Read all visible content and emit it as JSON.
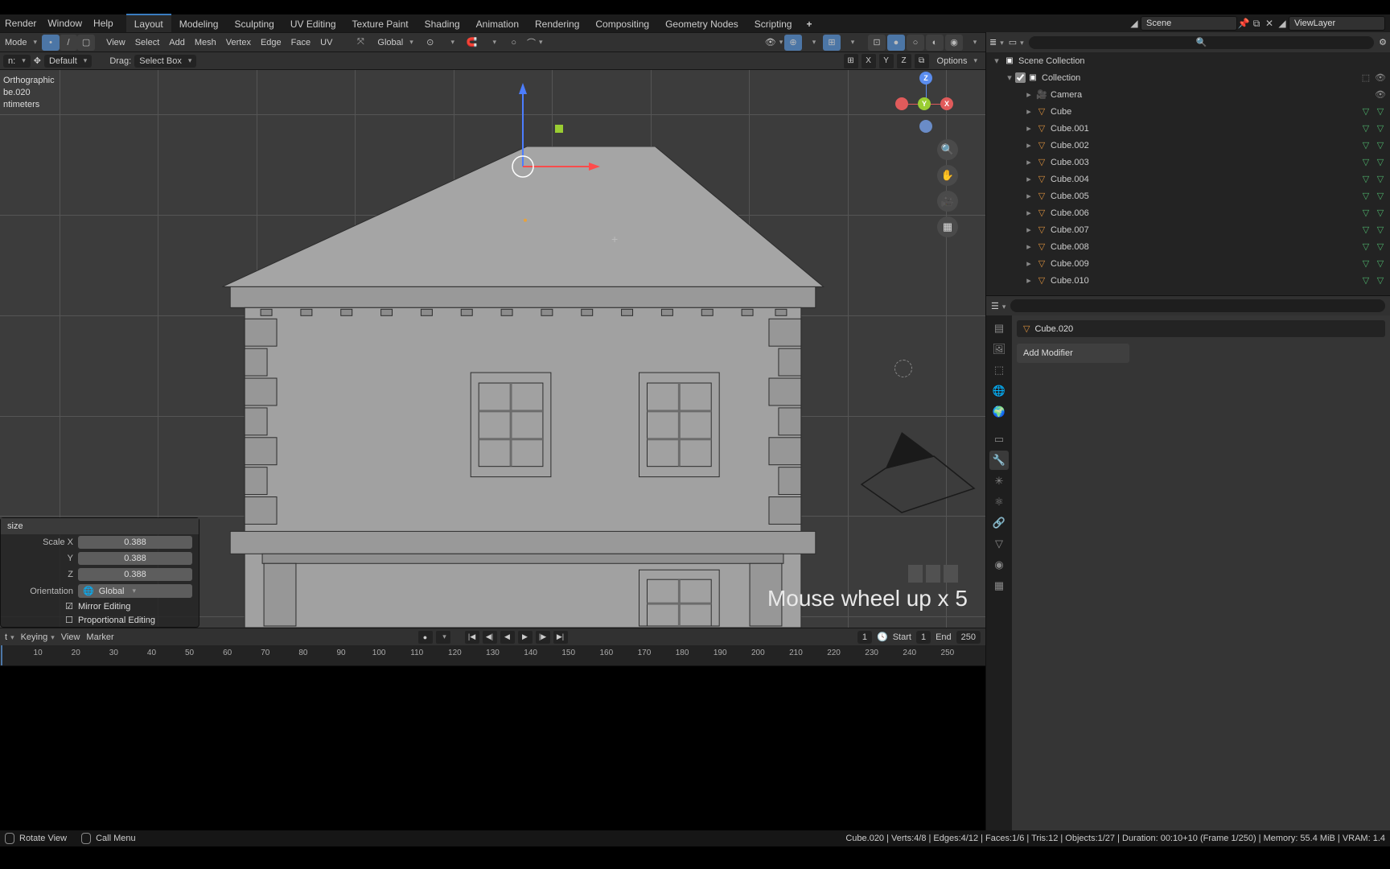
{
  "menus": {
    "app": [
      "Render",
      "Window",
      "Help"
    ]
  },
  "workspaces": [
    "Layout",
    "Modeling",
    "Sculpting",
    "UV Editing",
    "Texture Paint",
    "Shading",
    "Animation",
    "Rendering",
    "Compositing",
    "Geometry Nodes",
    "Scripting"
  ],
  "active_workspace": "Layout",
  "topbar": {
    "scene": "Scene",
    "view_layer": "ViewLayer"
  },
  "viewport_header": {
    "mode": "Mode",
    "menus": [
      "View",
      "Select",
      "Add",
      "Mesh",
      "Vertex",
      "Edge",
      "Face",
      "UV"
    ],
    "orient": "Global"
  },
  "tool_settings": {
    "preset": "Default",
    "drag_label": "Drag:",
    "drag": "Select Box",
    "xyz": [
      "X",
      "Y",
      "Z"
    ],
    "options": "Options"
  },
  "overlay": {
    "l1": "Orthographic",
    "l2": "be.020",
    "l3": "ntimeters"
  },
  "gizmo_labels": {
    "x": "X",
    "y": "Y",
    "z": "Z"
  },
  "mouse_hint": "Mouse wheel up x 5",
  "op_panel": {
    "title": "size",
    "scale_x_label": "Scale X",
    "scale_x": "0.388",
    "y_label": "Y",
    "y": "0.388",
    "z_label": "Z",
    "z": "0.388",
    "orient_label": "Orientation",
    "orient": "Global",
    "mirror": "Mirror Editing",
    "proportional": "Proportional Editing"
  },
  "timeline": {
    "keying": "Keying",
    "menus": [
      "View",
      "Marker"
    ],
    "current": "1",
    "start_label": "Start",
    "start": "1",
    "end_label": "End",
    "end": "250",
    "ticks": [
      "10",
      "20",
      "30",
      "40",
      "50",
      "60",
      "70",
      "80",
      "90",
      "100",
      "110",
      "120",
      "130",
      "140",
      "150",
      "160",
      "170",
      "180",
      "190",
      "200",
      "210",
      "220",
      "230",
      "240",
      "250"
    ]
  },
  "status": {
    "hint1": "Rotate View",
    "hint2": "Call Menu",
    "stats": "Cube.020 | Verts:4/8 | Edges:4/12 | Faces:1/6 | Tris:12 | Objects:1/27 | Duration: 00:10+10 (Frame 1/250) | Memory: 55.4 MiB | VRAM: 1.4"
  },
  "outliner": {
    "scene_collection": "Scene Collection",
    "collection": "Collection",
    "camera": "Camera",
    "cubes": [
      "Cube",
      "Cube.001",
      "Cube.002",
      "Cube.003",
      "Cube.004",
      "Cube.005",
      "Cube.006",
      "Cube.007",
      "Cube.008",
      "Cube.009",
      "Cube.010"
    ]
  },
  "props": {
    "crumb": "Cube.020",
    "add_modifier": "Add Modifier"
  }
}
